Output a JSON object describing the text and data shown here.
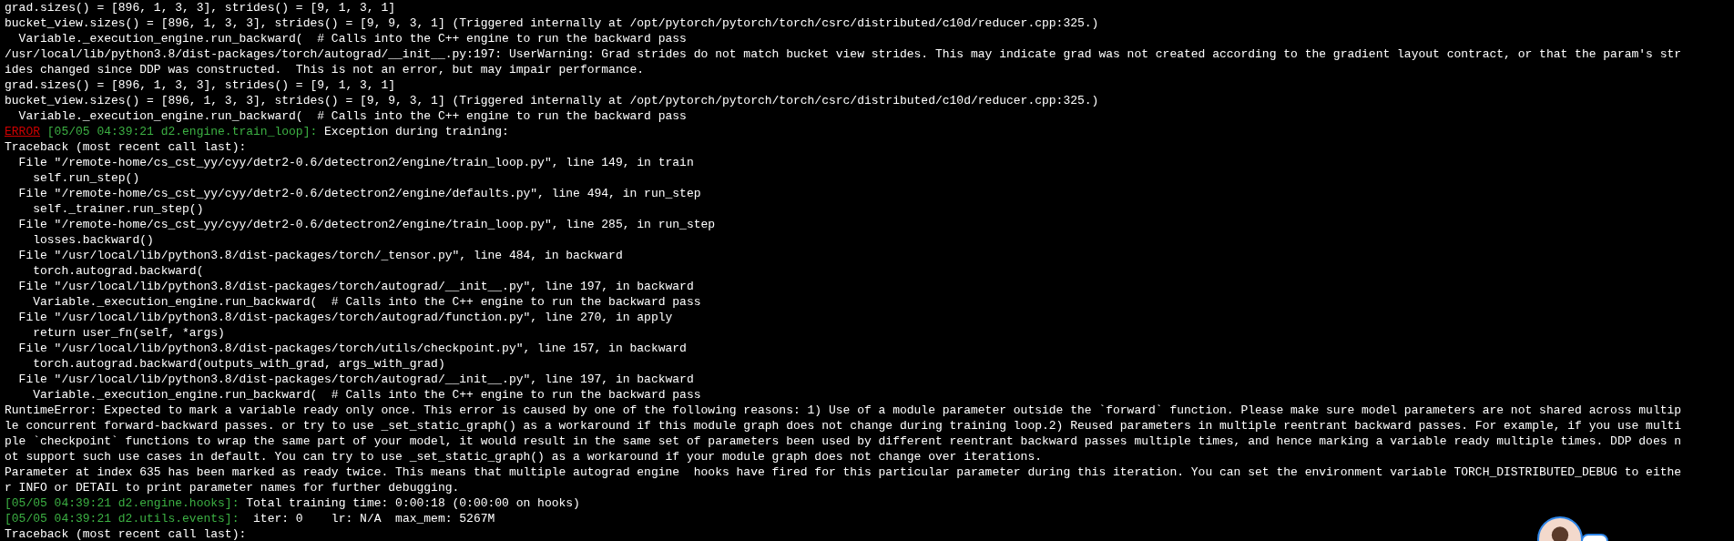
{
  "terminal": {
    "lines": [
      [
        {
          "kind": "plain",
          "text": "grad.sizes() = [896, 1, 3, 3], strides() = [9, 1, 3, 1]"
        }
      ],
      [
        {
          "kind": "plain",
          "text": "bucket_view.sizes() = [896, 1, 3, 3], strides() = [9, 9, 3, 1] (Triggered internally at /opt/pytorch/pytorch/torch/csrc/distributed/c10d/reducer.cpp:325.)"
        }
      ],
      [
        {
          "kind": "plain",
          "text": "  Variable._execution_engine.run_backward(  # Calls into the C++ engine to run the backward pass"
        }
      ],
      [
        {
          "kind": "plain",
          "text": "/usr/local/lib/python3.8/dist-packages/torch/autograd/__init__.py:197: UserWarning: Grad strides do not match bucket view strides. This may indicate grad was not created according to the gradient layout contract, or that the param's str"
        }
      ],
      [
        {
          "kind": "plain",
          "text": "ides changed since DDP was constructed.  This is not an error, but may impair performance."
        }
      ],
      [
        {
          "kind": "plain",
          "text": "grad.sizes() = [896, 1, 3, 3], strides() = [9, 1, 3, 1]"
        }
      ],
      [
        {
          "kind": "plain",
          "text": "bucket_view.sizes() = [896, 1, 3, 3], strides() = [9, 9, 3, 1] (Triggered internally at /opt/pytorch/pytorch/torch/csrc/distributed/c10d/reducer.cpp:325.)"
        }
      ],
      [
        {
          "kind": "plain",
          "text": "  Variable._execution_engine.run_backward(  # Calls into the C++ engine to run the backward pass"
        }
      ],
      [
        {
          "kind": "error-tag",
          "text": "ERROR"
        },
        {
          "kind": "log-tag",
          "text": " [05/05 04:39:21 d2.engine.train_loop]:"
        },
        {
          "kind": "plain",
          "text": " Exception during training:"
        }
      ],
      [
        {
          "kind": "plain",
          "text": "Traceback (most recent call last):"
        }
      ],
      [
        {
          "kind": "plain",
          "text": "  File \"/remote-home/cs_cst_yy/cyy/detr2-0.6/detectron2/engine/train_loop.py\", line 149, in train"
        }
      ],
      [
        {
          "kind": "plain",
          "text": "    self.run_step()"
        }
      ],
      [
        {
          "kind": "plain",
          "text": "  File \"/remote-home/cs_cst_yy/cyy/detr2-0.6/detectron2/engine/defaults.py\", line 494, in run_step"
        }
      ],
      [
        {
          "kind": "plain",
          "text": "    self._trainer.run_step()"
        }
      ],
      [
        {
          "kind": "plain",
          "text": "  File \"/remote-home/cs_cst_yy/cyy/detr2-0.6/detectron2/engine/train_loop.py\", line 285, in run_step"
        }
      ],
      [
        {
          "kind": "plain",
          "text": "    losses.backward()"
        }
      ],
      [
        {
          "kind": "plain",
          "text": "  File \"/usr/local/lib/python3.8/dist-packages/torch/_tensor.py\", line 484, in backward"
        }
      ],
      [
        {
          "kind": "plain",
          "text": "    torch.autograd.backward("
        }
      ],
      [
        {
          "kind": "plain",
          "text": "  File \"/usr/local/lib/python3.8/dist-packages/torch/autograd/__init__.py\", line 197, in backward"
        }
      ],
      [
        {
          "kind": "plain",
          "text": "    Variable._execution_engine.run_backward(  # Calls into the C++ engine to run the backward pass"
        }
      ],
      [
        {
          "kind": "plain",
          "text": "  File \"/usr/local/lib/python3.8/dist-packages/torch/autograd/function.py\", line 270, in apply"
        }
      ],
      [
        {
          "kind": "plain",
          "text": "    return user_fn(self, *args)"
        }
      ],
      [
        {
          "kind": "plain",
          "text": "  File \"/usr/local/lib/python3.8/dist-packages/torch/utils/checkpoint.py\", line 157, in backward"
        }
      ],
      [
        {
          "kind": "plain",
          "text": "    torch.autograd.backward(outputs_with_grad, args_with_grad)"
        }
      ],
      [
        {
          "kind": "plain",
          "text": "  File \"/usr/local/lib/python3.8/dist-packages/torch/autograd/__init__.py\", line 197, in backward"
        }
      ],
      [
        {
          "kind": "plain",
          "text": "    Variable._execution_engine.run_backward(  # Calls into the C++ engine to run the backward pass"
        }
      ],
      [
        {
          "kind": "plain",
          "text": "RuntimeError: Expected to mark a variable ready only once. This error is caused by one of the following reasons: 1) Use of a module parameter outside the `forward` function. Please make sure model parameters are not shared across multip"
        }
      ],
      [
        {
          "kind": "plain",
          "text": "le concurrent forward-backward passes. or try to use _set_static_graph() as a workaround if this module graph does not change during training loop.2) Reused parameters in multiple reentrant backward passes. For example, if you use multi"
        }
      ],
      [
        {
          "kind": "plain",
          "text": "ple `checkpoint` functions to wrap the same part of your model, it would result in the same set of parameters been used by different reentrant backward passes multiple times, and hence marking a variable ready multiple times. DDP does n"
        }
      ],
      [
        {
          "kind": "plain",
          "text": "ot support such use cases in default. You can try to use _set_static_graph() as a workaround if your module graph does not change over iterations."
        }
      ],
      [
        {
          "kind": "plain",
          "text": "Parameter at index 635 has been marked as ready twice. This means that multiple autograd engine  hooks have fired for this particular parameter during this iteration. You can set the environment variable TORCH_DISTRIBUTED_DEBUG to eithe"
        }
      ],
      [
        {
          "kind": "plain",
          "text": "r INFO or DETAIL to print parameter names for further debugging."
        }
      ],
      [
        {
          "kind": "log-tag",
          "text": "[05/05 04:39:21 d2.engine.hooks]:"
        },
        {
          "kind": "plain",
          "text": " Total training time: 0:00:18 (0:00:00 on hooks)"
        }
      ],
      [
        {
          "kind": "log-tag",
          "text": "[05/05 04:39:21 d2.utils.events]:"
        },
        {
          "kind": "plain",
          "text": "  iter: 0    lr: N/A  max_mem: 5267M"
        }
      ],
      [
        {
          "kind": "plain",
          "text": "Traceback (most recent call last):"
        }
      ]
    ]
  }
}
